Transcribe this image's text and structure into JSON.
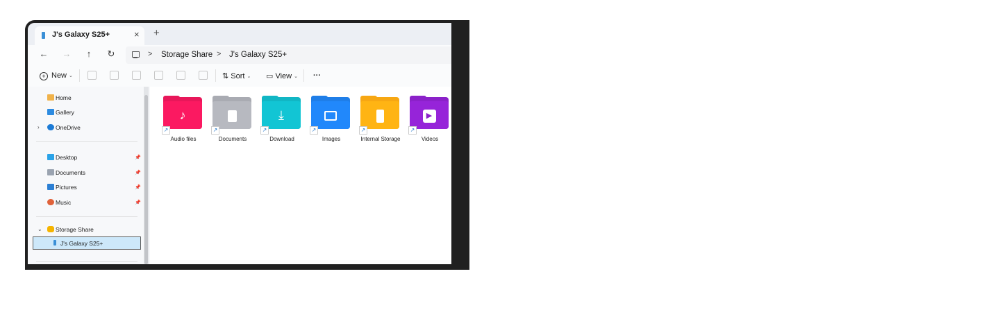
{
  "window": {
    "tab_title": "J's Galaxy S25+",
    "tab_close": "×",
    "new_tab": "+"
  },
  "navigation": {
    "back": "←",
    "forward": "→",
    "up": "↑",
    "refresh": "↻"
  },
  "breadcrumb": {
    "separator": ">",
    "items": [
      "Storage Share",
      "J's Galaxy S25+"
    ]
  },
  "toolbar": {
    "new_label": "New",
    "sort_label": "Sort",
    "view_label": "View",
    "more_label": "···",
    "caret": "⌄"
  },
  "sidebar": {
    "top_items": [
      {
        "label": "Home",
        "icon": "home-icon"
      },
      {
        "label": "Gallery",
        "icon": "gallery-icon"
      },
      {
        "label": "OneDrive",
        "icon": "onedrive-icon"
      }
    ],
    "pinned_items": [
      {
        "label": "Desktop",
        "icon": "desktop-icon"
      },
      {
        "label": "Documents",
        "icon": "documents-icon"
      },
      {
        "label": "Pictures",
        "icon": "pictures-icon"
      },
      {
        "label": "Music",
        "icon": "music-icon"
      }
    ],
    "storage_share": "Storage Share",
    "selected_device": "J's Galaxy S25+"
  },
  "folders": [
    {
      "label": "Audio files",
      "color": "#e8175a",
      "icon": "music-note-icon"
    },
    {
      "label": "Documents",
      "color": "#a9abb2",
      "icon": "document-icon"
    },
    {
      "label": "Download",
      "color": "#11b6c4",
      "icon": "download-icon"
    },
    {
      "label": "Images",
      "color": "#1f7ee8",
      "icon": "image-icon"
    },
    {
      "label": "Internal Storage",
      "color": "#f7a712",
      "icon": "phone-icon"
    },
    {
      "label": "Videos",
      "color": "#8b21c9",
      "icon": "play-icon"
    }
  ],
  "colors": {
    "accent": "#0067c0",
    "selection": "#cde8fa"
  }
}
